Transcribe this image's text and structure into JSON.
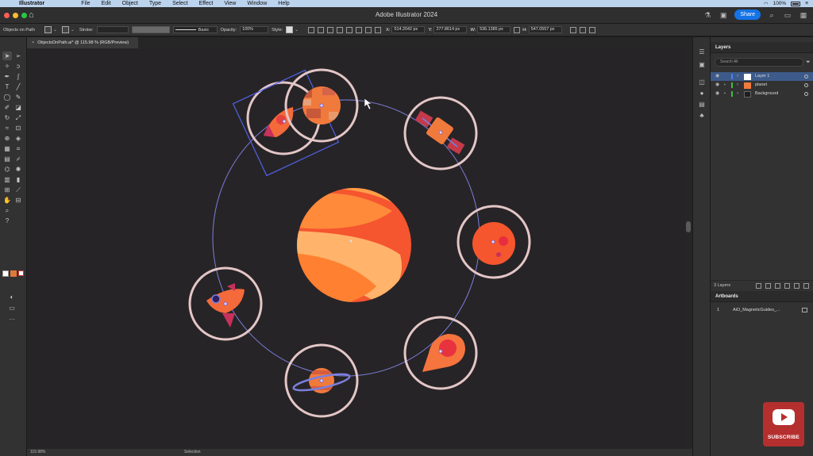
{
  "menubar": {
    "app_name": "Illustrator",
    "items": [
      "File",
      "Edit",
      "Object",
      "Type",
      "Select",
      "Effect",
      "View",
      "Window",
      "Help"
    ],
    "battery": "100%"
  },
  "titlebar": {
    "title": "Adobe Illustrator 2024",
    "share_label": "Share"
  },
  "control_bar": {
    "selection_label": "Objects on Path",
    "stroke_label": "Stroke:",
    "stroke_style": "Basic",
    "opacity_label": "Opacity:",
    "opacity_value": "100%",
    "style_label": "Style:",
    "x_label": "X:",
    "x_value": "514.2042 px",
    "y_label": "Y:",
    "y_value": "277.8614 px",
    "w_label": "W:",
    "w_value": "536.1385 px",
    "h_label": "H:",
    "h_value": "547.0557 px"
  },
  "document_tab": {
    "close": "×",
    "label": "ObjectsOnPath.ai* @ 115.98 % (RGB/Preview)"
  },
  "status_bar": {
    "zoom": "115.98%",
    "tool": "Selection"
  },
  "layers_panel": {
    "title": "Layers",
    "search_placeholder": "Search All",
    "layers": [
      {
        "name": "Layer 1",
        "color": "#4a7df0",
        "selected": true
      },
      {
        "name": "planet",
        "color": "#3fbf3f",
        "selected": false
      },
      {
        "name": "Background",
        "color": "#3fbf3f",
        "selected": false
      }
    ],
    "count_label": "3 Layers"
  },
  "artboards_panel": {
    "title": "Artboards",
    "rows": [
      {
        "number": "1",
        "name": "AiO_MagneticGuides_..."
      }
    ]
  },
  "overlay": {
    "subscribe_label": "SUBSCRIBE"
  },
  "colors": {
    "accent": "#1473e6",
    "canvas": "#272427",
    "planet_orange": "#f7743a",
    "ring": "#e3c6c6",
    "path": "#7b7fdc"
  }
}
